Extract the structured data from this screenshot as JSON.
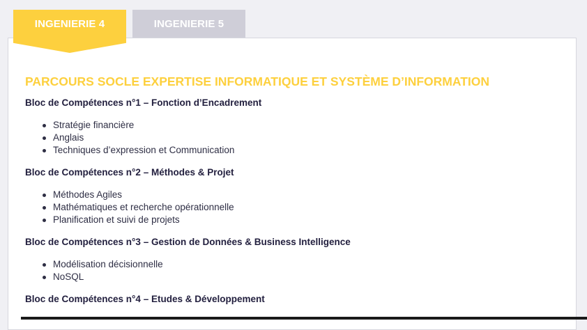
{
  "tabs": [
    {
      "label": "INGENIERIE 4",
      "active": true
    },
    {
      "label": "INGENIERIE 5",
      "active": false
    }
  ],
  "section": {
    "title": "PARCOURS SOCLE EXPERTISE INFORMATIQUE ET SYSTÈME D’INFORMATION"
  },
  "blocs": [
    {
      "title": "Bloc de Compétences n°1 – Fonction d’Encadrement",
      "items": [
        "Stratégie financière",
        "Anglais",
        "Techniques d’expression et Communication"
      ]
    },
    {
      "title": "Bloc de Compétences n°2 – Méthodes & Projet",
      "items": [
        "Méthodes Agiles",
        "Mathématiques et recherche opérationnelle",
        "Planification et suivi de projets"
      ]
    },
    {
      "title": "Bloc de Compétences n°3 – Gestion de Données & Business Intelligence",
      "items": [
        "Modélisation décisionnelle",
        "NoSQL"
      ]
    },
    {
      "title": "Bloc de Compétences n°4 – Etudes & Développement",
      "items": []
    }
  ],
  "colors": {
    "accent": "#fdd03e",
    "tab_inactive": "#cfced8",
    "text": "#23203f"
  }
}
